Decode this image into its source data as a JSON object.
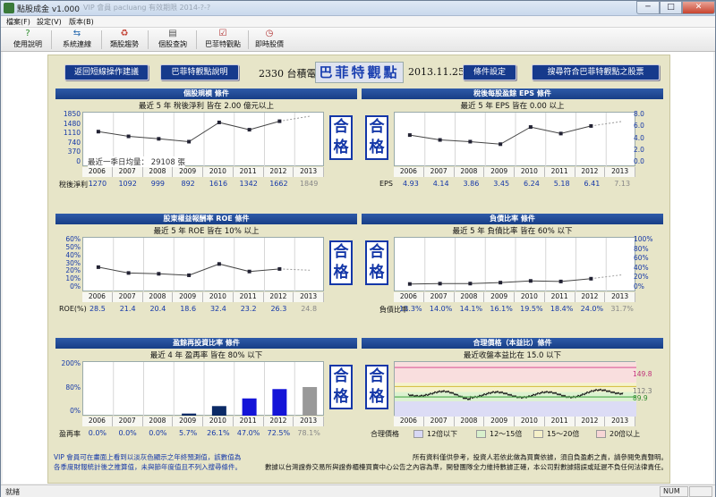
{
  "window": {
    "title": "點股成金 v1.000",
    "ghost_title": "VIP 會員 pacluang 有效期限 2014-?-?",
    "min": "─",
    "max": "□",
    "close": "✕"
  },
  "menu": [
    "檔案(F)",
    "設定(V)",
    "版本(B)"
  ],
  "toolbar": [
    {
      "label": "使用說明",
      "icon": "help-icon",
      "glyph": "?",
      "color": "#2a8a2a"
    },
    {
      "label": "系統連線",
      "icon": "connect-icon",
      "glyph": "⇆",
      "color": "#2b6cb0"
    },
    {
      "label": "類股趨勢",
      "icon": "trend-icon",
      "glyph": "♻",
      "color": "#c0392b"
    },
    {
      "label": "個股查詢",
      "icon": "search-doc-icon",
      "glyph": "▤",
      "color": "#555"
    },
    {
      "label": "巴菲特觀點",
      "icon": "checklist-icon",
      "glyph": "☑",
      "color": "#b03030"
    },
    {
      "label": "即時股價",
      "icon": "clock-icon",
      "glyph": "◷",
      "color": "#b03030"
    }
  ],
  "nav": {
    "back": "返回短線操作建議",
    "explain": "巴菲特觀點說明",
    "settings": "條件設定",
    "find": "搜尋符合巴菲特觀點之股票"
  },
  "stock": {
    "code_name": "2330 台積電",
    "headline": "巴菲特觀點",
    "date": "2013.11.25"
  },
  "years": [
    "2006",
    "2007",
    "2008",
    "2009",
    "2010",
    "2011",
    "2012",
    "2013"
  ],
  "panels": [
    {
      "id": "net-income",
      "title": "個股規模 條件",
      "subtitle": "最近 5 年 稅後淨利 皆在 2.00 億元以上",
      "stamp": [
        "合",
        "格"
      ],
      "value_label": "稅後淨利",
      "values": [
        "1270",
        "1092",
        "999",
        "892",
        "1616",
        "1342",
        "1662",
        "1849"
      ],
      "yaxis": [
        "1850",
        "1480",
        "1110",
        "740",
        "370",
        "0"
      ],
      "note": "最近一季日均量： 29108 張"
    },
    {
      "id": "eps",
      "title": "稅後每股盈餘 EPS 條件",
      "subtitle": "最近 5 年 EPS 皆在 0.00 以上",
      "stamp": [
        "合",
        "格"
      ],
      "value_label": "EPS",
      "values": [
        "4.93",
        "4.14",
        "3.86",
        "3.45",
        "6.24",
        "5.18",
        "6.41",
        "7.13"
      ],
      "yaxis": [
        "8.0",
        "6.0",
        "4.0",
        "2.0",
        "0.0"
      ]
    },
    {
      "id": "roe",
      "title": "股東權益報酬率 ROE 條件",
      "subtitle": "最近 5 年 ROE 皆在 10% 以上",
      "stamp": [
        "合",
        "格"
      ],
      "value_label": "ROE(%)",
      "values": [
        "28.5",
        "21.4",
        "20.4",
        "18.6",
        "32.4",
        "23.2",
        "26.3",
        "24.8"
      ],
      "yaxis": [
        "60%",
        "50%",
        "40%",
        "30%",
        "20%",
        "10%",
        "0%"
      ]
    },
    {
      "id": "debt",
      "title": "負債比率 條件",
      "subtitle": "最近 5 年 負債比率 皆在 60% 以下",
      "stamp": [
        "合",
        "格"
      ],
      "value_label": "負債比率",
      "values": [
        "13.3%",
        "14.0%",
        "14.1%",
        "16.1%",
        "19.5%",
        "18.4%",
        "24.0%",
        "31.7%"
      ],
      "yaxis": [
        "100%",
        "80%",
        "60%",
        "40%",
        "20%",
        "0%"
      ]
    },
    {
      "id": "reinvest",
      "title": "盈餘再投資比率 條件",
      "subtitle": "最近 4 年 盈再率 皆在 80% 以下",
      "stamp": [
        "合",
        "格"
      ],
      "value_label": "盈再率",
      "values": [
        "0.0%",
        "0.0%",
        "0.0%",
        "5.7%",
        "26.1%",
        "47.0%",
        "72.5%",
        "78.1%"
      ],
      "yaxis": [
        "200%",
        "80%",
        "0%"
      ]
    },
    {
      "id": "pe",
      "title": "合理價格（本益比）條件",
      "subtitle": "最近收盤本益比在 15.0 以下",
      "stamp": [
        "合",
        "格"
      ],
      "value_label": "合理價格",
      "yaxis_right": [
        "149.8",
        "112.3",
        "89.9"
      ],
      "legend": [
        "12倍以下",
        "12～15倍",
        "15～20倍",
        "20倍以上"
      ],
      "legend_colors": [
        "#d8d8f5",
        "#d8f0cc",
        "#f5f0c8",
        "#f7d6d6"
      ]
    }
  ],
  "chart_data": [
    {
      "type": "line",
      "title": "個股規模 條件",
      "categories": [
        "2006",
        "2007",
        "2008",
        "2009",
        "2010",
        "2011",
        "2012",
        "2013"
      ],
      "series": [
        {
          "name": "稅後淨利",
          "values": [
            1270,
            1092,
            999,
            892,
            1616,
            1342,
            1662,
            1849
          ]
        }
      ],
      "ylim": [
        0,
        1850
      ]
    },
    {
      "type": "line",
      "title": "稅後每股盈餘 EPS 條件",
      "categories": [
        "2006",
        "2007",
        "2008",
        "2009",
        "2010",
        "2011",
        "2012",
        "2013"
      ],
      "series": [
        {
          "name": "EPS",
          "values": [
            4.93,
            4.14,
            3.86,
            3.45,
            6.24,
            5.18,
            6.41,
            7.13
          ]
        }
      ],
      "ylim": [
        0,
        8
      ]
    },
    {
      "type": "line",
      "title": "股東權益報酬率 ROE 條件",
      "categories": [
        "2006",
        "2007",
        "2008",
        "2009",
        "2010",
        "2011",
        "2012",
        "2013"
      ],
      "series": [
        {
          "name": "ROE(%)",
          "values": [
            28.5,
            21.4,
            20.4,
            18.6,
            32.4,
            23.2,
            26.3,
            24.8
          ]
        }
      ],
      "ylim": [
        0,
        60
      ]
    },
    {
      "type": "line",
      "title": "負債比率 條件",
      "categories": [
        "2006",
        "2007",
        "2008",
        "2009",
        "2010",
        "2011",
        "2012",
        "2013"
      ],
      "series": [
        {
          "name": "負債比率",
          "values": [
            13.3,
            14.0,
            14.1,
            16.1,
            19.5,
            18.4,
            24.0,
            31.7
          ]
        }
      ],
      "ylim": [
        0,
        100
      ]
    },
    {
      "type": "bar",
      "title": "盈餘再投資比率 條件",
      "categories": [
        "2006",
        "2007",
        "2008",
        "2009",
        "2010",
        "2011",
        "2012",
        "2013"
      ],
      "series": [
        {
          "name": "盈再率",
          "values": [
            0.0,
            0.0,
            0.0,
            5.7,
            26.1,
            47.0,
            72.5,
            78.1
          ]
        }
      ],
      "ylim": [
        0,
        200
      ]
    }
  ],
  "footer": {
    "left": [
      "VIP 會員可在畫面上看到以淡灰色顯示之年終預測值，該數值為",
      "各季度財報統計後之推算值，未與節年度值且不列入搜尋條件。"
    ],
    "right": [
      "所有資料僅供參考，投資人若依此做為買賣依據，須自負盈虧之責，請參閱免責聲明。",
      "數據以台灣證券交易所與證券櫃檯買賣中心公告之內容為準，開發團隊全力維持數據正確，本公司對數據錯誤或延遲不負任何法律責任。"
    ]
  },
  "status": {
    "text": "就緒",
    "num": "NUM"
  }
}
